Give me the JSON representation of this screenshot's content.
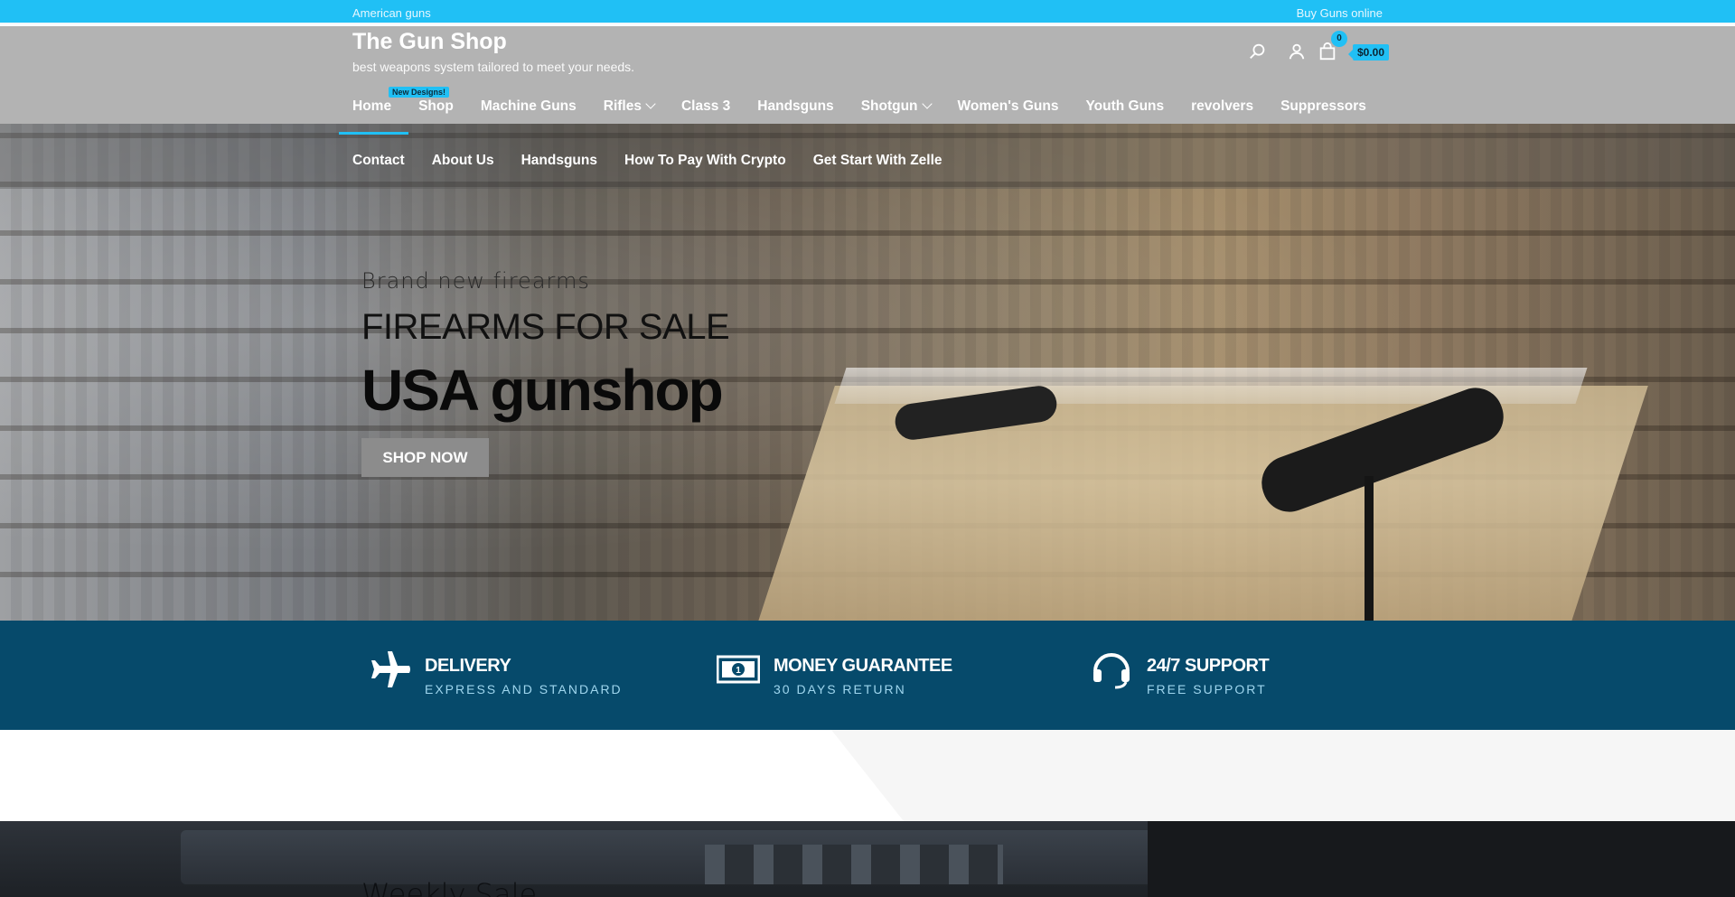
{
  "topbar": {
    "left": "American guns",
    "right": "Buy Guns online"
  },
  "brand": {
    "title": "The Gun Shop",
    "tagline": "best weapons system tailored to meet your needs."
  },
  "cart": {
    "count": "0",
    "total": "$0.00"
  },
  "nav_badge": "New Designs!",
  "nav_primary": [
    {
      "label": "Home"
    },
    {
      "label": "Shop"
    },
    {
      "label": "Machine Guns"
    },
    {
      "label": "Rifles",
      "has_dropdown": true
    },
    {
      "label": "Class 3"
    },
    {
      "label": "Handsguns"
    },
    {
      "label": "Shotgun",
      "has_dropdown": true
    },
    {
      "label": "Women's Guns"
    },
    {
      "label": "Youth Guns"
    },
    {
      "label": "revolvers"
    },
    {
      "label": "Suppressors"
    }
  ],
  "nav_secondary": [
    {
      "label": "Contact"
    },
    {
      "label": "About Us"
    },
    {
      "label": "Handsguns"
    },
    {
      "label": "How To Pay With Crypto"
    },
    {
      "label": "Get Start With Zelle"
    }
  ],
  "hero": {
    "eyebrow": "Brand new firearms",
    "heading": "FIREARMS FOR SALE",
    "title": "USA gunshop",
    "button": "SHOP NOW"
  },
  "features": [
    {
      "icon": "airplane-icon",
      "title": "DELIVERY",
      "subtitle": "EXPRESS AND STANDARD"
    },
    {
      "icon": "money-icon",
      "title": "MONEY GUARANTEE",
      "subtitle": "30 DAYS RETURN"
    },
    {
      "icon": "headset-icon",
      "title": "24/7 SUPPORT",
      "subtitle": "FREE SUPPORT"
    }
  ],
  "weekly": {
    "title": "Weekly Sale"
  },
  "colors": {
    "accent": "#20c0f5",
    "header_bg": "#b3b3b3",
    "feature_bg": "#064a6b"
  }
}
